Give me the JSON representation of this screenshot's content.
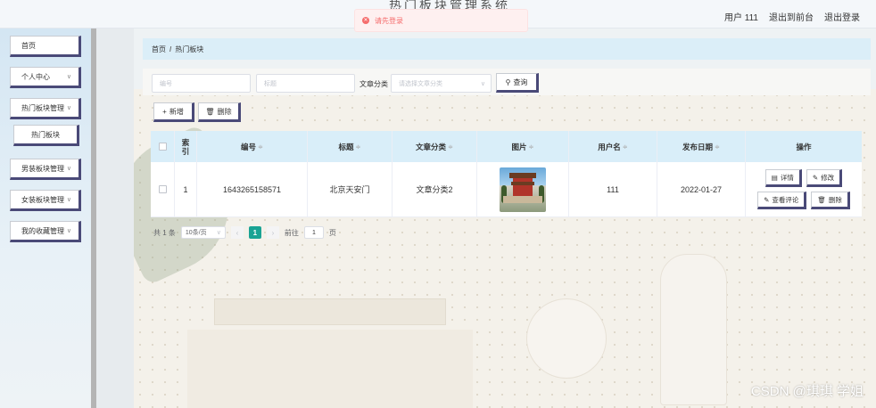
{
  "header": {
    "title": "热门板块管理系统",
    "user": "用户 111",
    "back_to_front": "退出到前台",
    "logout": "退出登录"
  },
  "toast": {
    "message": "请先登录"
  },
  "sidebar": {
    "items": [
      {
        "label": "首页"
      },
      {
        "label": "个人中心"
      },
      {
        "label": "热门板块管理"
      },
      {
        "label": "热门板块"
      },
      {
        "label": "男装板块管理"
      },
      {
        "label": "女装板块管理"
      },
      {
        "label": "我的收藏管理"
      }
    ]
  },
  "breadcrumb": {
    "home": "首页",
    "separator": "/",
    "current": "热门板块"
  },
  "search": {
    "number_placeholder": "编号",
    "title_placeholder": "标题",
    "category_label": "文章分类",
    "category_placeholder": "请选择文章分类",
    "query_button": "查询"
  },
  "toolbar": {
    "add": "新增",
    "delete": "删除"
  },
  "table": {
    "headers": {
      "index": "索引",
      "number": "编号",
      "title": "标题",
      "category": "文章分类",
      "image": "图片",
      "username": "用户名",
      "date": "发布日期",
      "actions": "操作"
    },
    "rows": [
      {
        "index": "1",
        "number": "1643265158571",
        "title": "北京天安门",
        "category": "文章分类2",
        "username": "111",
        "date": "2022-01-27"
      }
    ],
    "actions": {
      "detail": "详情",
      "edit": "修改",
      "comments": "查看评论",
      "delete": "删除"
    }
  },
  "pagination": {
    "total": "共 1 条",
    "page_size": "10条/页",
    "current_page": "1",
    "goto_label": "前往",
    "goto_value": "1",
    "page_unit": "页"
  },
  "watermark": "CSDN @琪琪 学姐",
  "colors": {
    "accent": "#1aa394",
    "button_border": "#4a4a78",
    "header_bg": "#d9eef9",
    "error": "#f56c6c"
  }
}
